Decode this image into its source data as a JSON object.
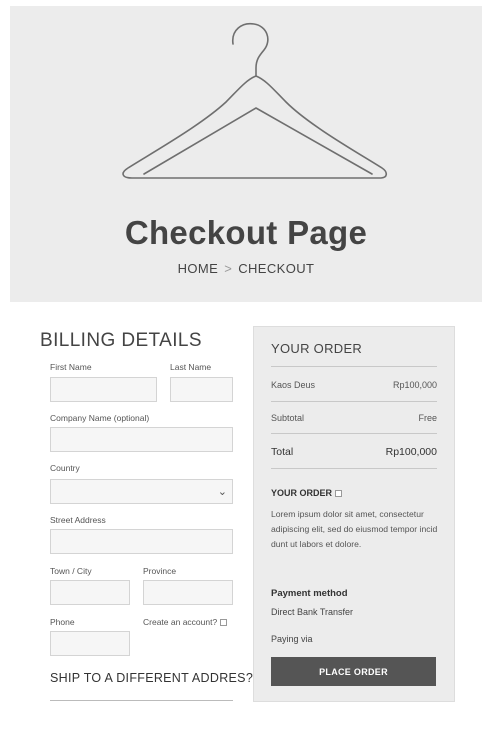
{
  "hero": {
    "title": "Checkout Page",
    "breadcrumb": {
      "home": "HOME",
      "separator": ">",
      "current": "CHECKOUT"
    }
  },
  "billing": {
    "heading": "BILLING DETAILS",
    "fields": {
      "first_name": "First Name",
      "last_name": "Last Name",
      "company": "Company Name (optional)",
      "country": "Country",
      "street": "Street Address",
      "town": "Town / City",
      "province": "Province",
      "phone": "Phone",
      "create_account": "Create an account?"
    },
    "ship_heading": "SHIP TO A DIFFERENT ADDRES?"
  },
  "order": {
    "heading": "YOUR ORDER",
    "item": {
      "name": "Kaos Deus",
      "price": "Rp100,000"
    },
    "subtotal": {
      "label": "Subtotal",
      "value": "Free"
    },
    "total": {
      "label": "Total",
      "value": "Rp100,000"
    },
    "note_heading": "YOUR ORDER",
    "note_text": "Lorem ipsum dolor sit amet, consectetur adipiscing elit,  sed do eiusmod tempor incid dunt ut labors et dolore.",
    "payment_heading": "Payment method",
    "payment_value": "Direct Bank Transfer",
    "paying_via": "Paying via",
    "place_order": "PLACE ORDER"
  },
  "colors": {
    "hero_bg": "#ececec",
    "button_bg": "#555555",
    "panel_bg": "#ececec"
  }
}
